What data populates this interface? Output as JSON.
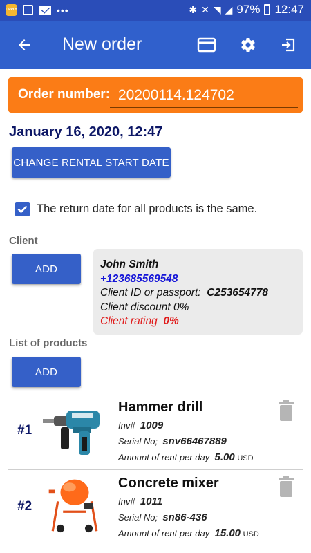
{
  "status_bar": {
    "badge": "OPPLY",
    "battery": "97%",
    "time": "12:47"
  },
  "app_bar": {
    "title": "New order"
  },
  "order": {
    "label": "Order number:",
    "number": "20200114.124702"
  },
  "rental": {
    "start_date": "January 16, 2020, 12:47",
    "change_button": "CHANGE RENTAL START DATE",
    "same_return_label": "The return date for all products is the same.",
    "same_return_checked": true
  },
  "client_section": {
    "title": "Client",
    "add_button": "ADD",
    "card": {
      "name": "John Smith",
      "phone": "+123685569548",
      "id_label": "Client ID or passport:",
      "id_value": "C253654778",
      "discount": "Client discount 0%",
      "rating_label": "Client rating",
      "rating_value": "0%"
    }
  },
  "products_section": {
    "title": "List of products",
    "add_button": "ADD",
    "inv_label": "Inv#",
    "serial_label": "Serial No;",
    "rent_label": "Amount of rent per day",
    "currency": "USD",
    "items": [
      {
        "index": "#1",
        "name": "Hammer drill",
        "inv": "1009",
        "serial": "snv66467889",
        "rent": "5.00"
      },
      {
        "index": "#2",
        "name": "Concrete mixer",
        "inv": "1011",
        "serial": "sn86-436",
        "rent": "15.00"
      }
    ]
  },
  "colors": {
    "status_bar": "#2a4db8",
    "app_bar": "#3060cc",
    "order_bar": "#fb7c16",
    "button": "#3560c8",
    "date_text": "#0d1766",
    "phone": "#1515d8",
    "rating": "#e01b1b"
  },
  "icons": {
    "back": "arrow-left-icon",
    "card": "credit-card-icon",
    "settings": "gear-icon",
    "exit": "exit-icon",
    "delete": "trash-icon"
  }
}
